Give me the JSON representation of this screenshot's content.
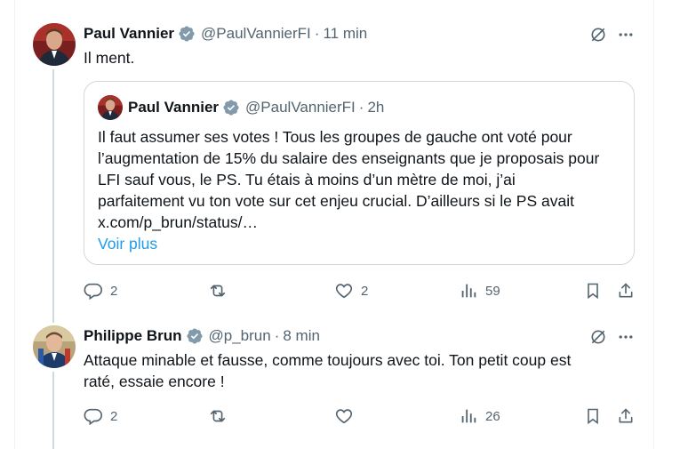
{
  "tweets": [
    {
      "name": "Paul Vannier",
      "handle": "@PaulVannierFI",
      "dot": "·",
      "time": "11 min",
      "text": "Il ment.",
      "quote": {
        "name": "Paul Vannier",
        "handle": "@PaulVannierFI",
        "dot": "·",
        "time": "2h",
        "lines": [
          "Il faut assumer ses votes ! Tous les groupes de gauche ont voté pour",
          "l’augmentation de 15% du salaire des enseignants que je proposais pour",
          "LFI sauf vous, le PS. Tu étais à moins d’un mètre de moi, j’ai",
          "parfaitement vu ton vote sur cet enjeu crucial. D’ailleurs si le PS avait",
          "x.com/p_brun/status/…"
        ],
        "more": "Voir plus"
      },
      "actions": {
        "replies": "2",
        "reposts": "",
        "likes": "2",
        "views": "59"
      }
    },
    {
      "name": "Philippe Brun",
      "handle": "@p_brun",
      "dot": "·",
      "time": "8 min",
      "lines": [
        "Attaque minable et fausse, comme toujours avec toi. Ton petit coup est",
        "raté, essaie encore !"
      ],
      "actions": {
        "replies": "2",
        "reposts": "",
        "likes": "",
        "views": "26"
      }
    }
  ],
  "colors": {
    "verified": "#829aab",
    "link": "#1d9bf0",
    "muted": "#536471"
  },
  "icons": [
    "verified-badge-icon",
    "grok-icon",
    "more-icon",
    "reply-icon",
    "repost-icon",
    "like-icon",
    "views-icon",
    "bookmark-icon",
    "share-icon"
  ]
}
